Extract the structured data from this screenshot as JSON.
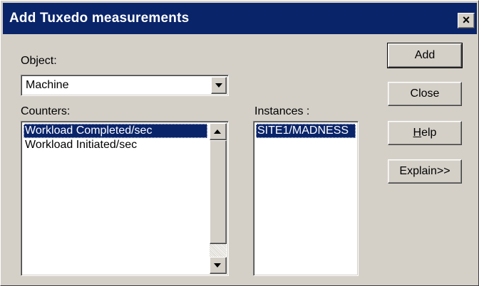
{
  "window": {
    "title": "Add Tuxedo measurements",
    "close_glyph": "×"
  },
  "object": {
    "label": "Object:",
    "value": "Machine"
  },
  "counters": {
    "label": "Counters:",
    "items": [
      {
        "label": "Workload Completed/sec",
        "selected": true
      },
      {
        "label": "Workload Initiated/sec",
        "selected": false
      }
    ]
  },
  "instances": {
    "label": "Instances :",
    "items": [
      {
        "label": "SITE1/MADNESS",
        "selected": true
      }
    ]
  },
  "buttons": {
    "add": "Add",
    "close": "Close",
    "help_mnemonic": "H",
    "help_rest": "elp",
    "explain": "Explain>>"
  },
  "colors": {
    "titlebar": "#0a246a",
    "selection": "#0a246a",
    "face": "#d4d0c8"
  }
}
